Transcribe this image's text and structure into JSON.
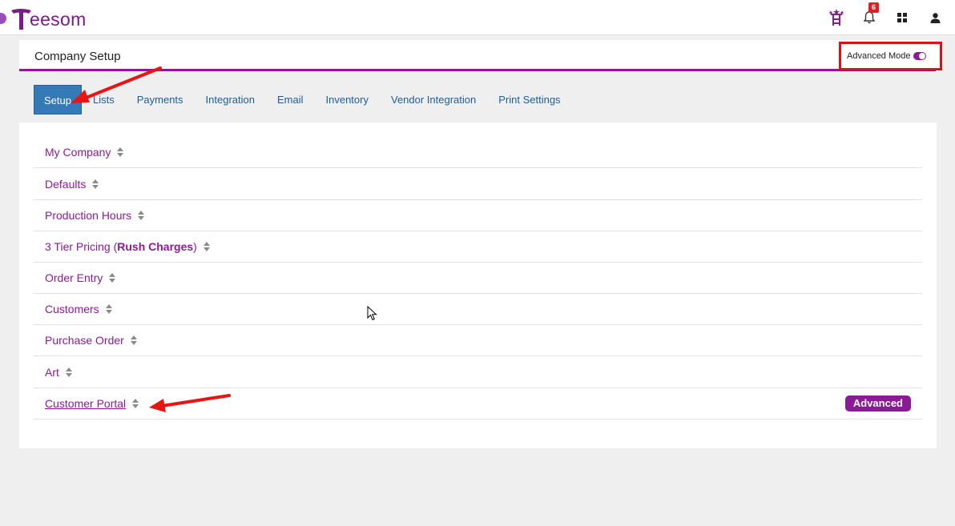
{
  "app": {
    "logo_text": "eesom",
    "notification_count": "6"
  },
  "header": {
    "title": "Company Setup",
    "advanced_mode_label": "Advanced Mode",
    "advanced_mode_on": true
  },
  "tabs": [
    {
      "label": "Setup",
      "active": true
    },
    {
      "label": "Lists"
    },
    {
      "label": "Payments"
    },
    {
      "label": "Integration"
    },
    {
      "label": "Email"
    },
    {
      "label": "Inventory"
    },
    {
      "label": "Vendor Integration"
    },
    {
      "label": "Print Settings"
    }
  ],
  "sections": [
    {
      "label": "My Company"
    },
    {
      "label": "Defaults"
    },
    {
      "label": "Production Hours"
    },
    {
      "label_prefix": "3 Tier Pricing (",
      "label_bold": "Rush Charges",
      "label_suffix": ")"
    },
    {
      "label": "Order Entry"
    },
    {
      "label": "Customers"
    },
    {
      "label": "Purchase Order"
    },
    {
      "label": "Art"
    },
    {
      "label": "Customer Portal",
      "badge": "Advanced"
    }
  ],
  "colors": {
    "brand": "#8c1a96",
    "tab_active": "#337ab7",
    "link": "#1b5e9b",
    "badge": "#e02020",
    "highlight": "#e01010"
  },
  "icons": [
    "tournament-icon",
    "bell-icon",
    "apps-grid-icon",
    "user-icon",
    "sort-icon",
    "toggle-on-icon"
  ]
}
